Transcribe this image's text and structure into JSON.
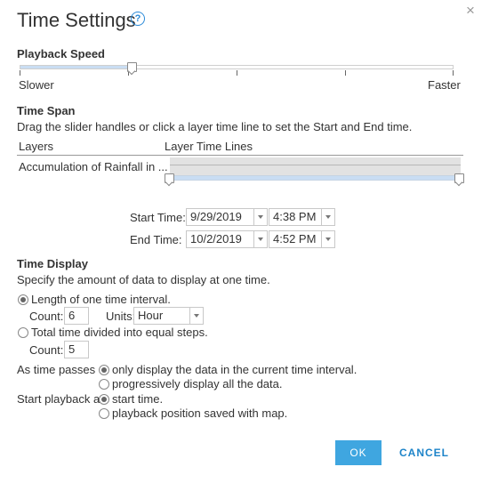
{
  "dialog": {
    "title": "Time Settings",
    "help_glyph": "?",
    "close_glyph": "×"
  },
  "playback_speed": {
    "heading": "Playback Speed",
    "slower_label": "Slower",
    "faster_label": "Faster",
    "value_fraction": 0.26
  },
  "time_span": {
    "heading": "Time Span",
    "instructions": "Drag the slider handles or click a layer time line to set the Start and End time.",
    "columns": {
      "layers": "Layers",
      "time_lines": "Layer Time Lines"
    },
    "layer_name": "Accumulation of Rainfall in ...",
    "start_label": "Start Time:",
    "start_date": "9/29/2019",
    "start_time": "4:38 PM",
    "end_label": "End Time:",
    "end_date": "10/2/2019",
    "end_time": "4:52 PM"
  },
  "time_display": {
    "heading": "Time Display",
    "description": "Specify the amount of data to display at one time.",
    "option_interval": "Length of one time interval.",
    "count_label": "Count:",
    "interval_count": "6",
    "units_label": "Units:",
    "units_value": "Hour",
    "option_steps": "Total time divided into equal steps.",
    "steps_count": "5",
    "as_time_passes_label": "As time passes",
    "passes_option_current": "only display the data in the current time interval.",
    "passes_option_all": "progressively display all the data.",
    "start_playback_label": "Start playback at",
    "start_option_time": "start time.",
    "start_option_saved": "playback position saved with map."
  },
  "buttons": {
    "ok": "OK",
    "cancel": "CANCEL"
  },
  "colors": {
    "accent": "#3fa6e0",
    "link": "#1d84c9",
    "slider_fill": "#c9ddf3"
  }
}
